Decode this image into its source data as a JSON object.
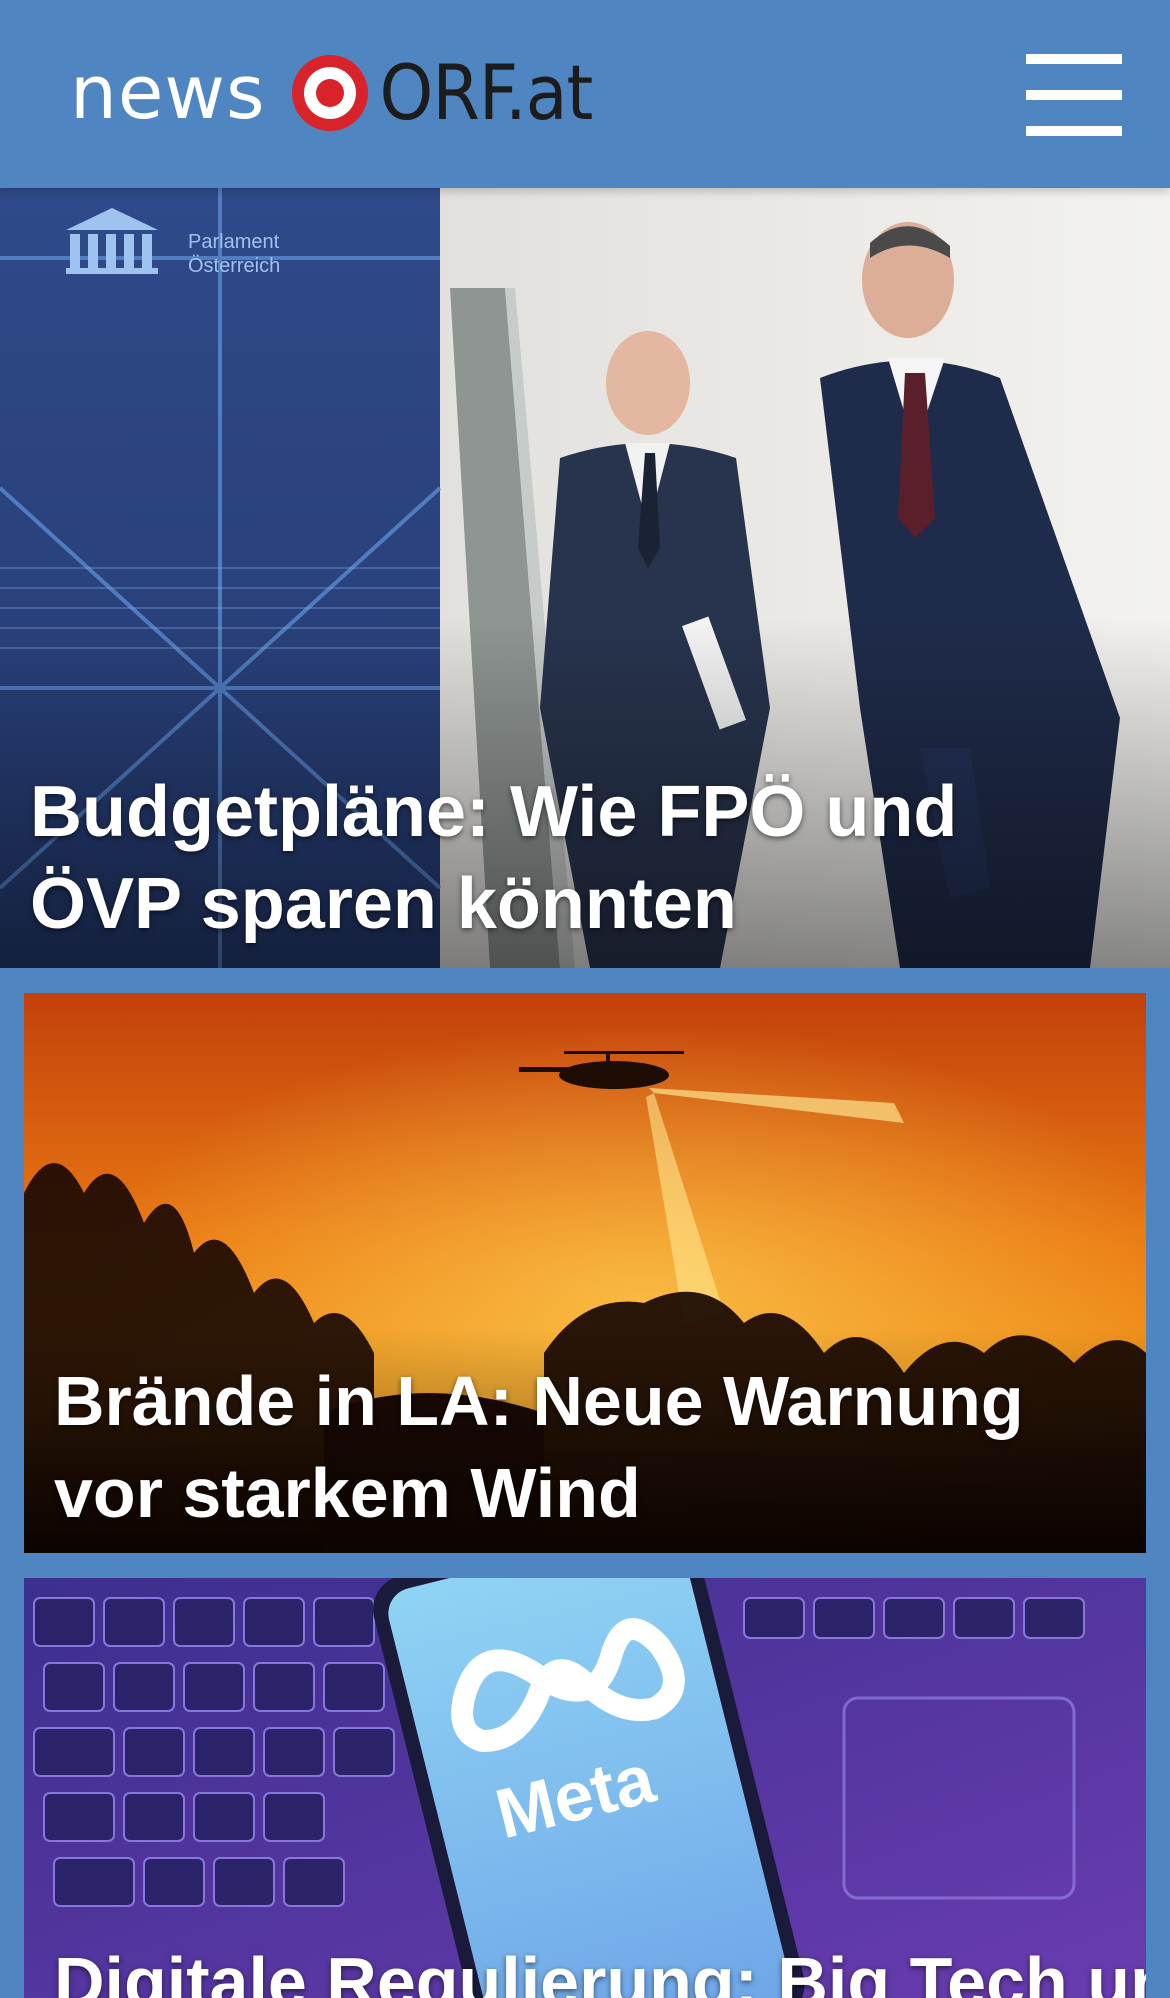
{
  "header": {
    "logo_news": "news",
    "logo_orf": "ORF.at",
    "logo_icon": "orf-target-icon",
    "menu_icon": "hamburger-menu-icon"
  },
  "stories": [
    {
      "headline": "Budgetpläne: Wie FPÖ und ÖVP sparen könnten",
      "image": {
        "description_icon": "parliament-press-photo",
        "sign_text": "Parlament\nÖsterreich"
      }
    },
    {
      "headline": "Brände in LA: Neue Warnung vor starkem Wind",
      "image": {
        "description_icon": "helicopter-wildfire-photo"
      }
    },
    {
      "headline": "Digitale Regulierung: Big Tech und",
      "image": {
        "description_icon": "meta-phone-keyboard-photo",
        "phone_text": "Meta"
      }
    }
  ],
  "colors": {
    "brand_blue": "#4f86c2",
    "orf_red": "#d8232a",
    "text_dark": "#1c1c1c",
    "headline_white": "#ffffff"
  }
}
